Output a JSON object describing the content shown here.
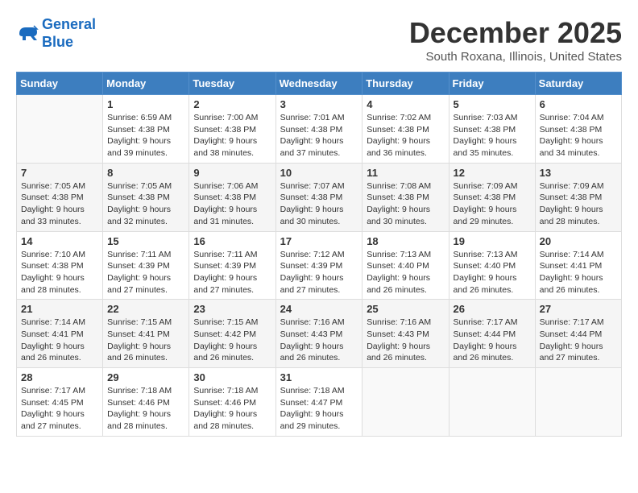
{
  "header": {
    "logo_line1": "General",
    "logo_line2": "Blue",
    "month": "December 2025",
    "location": "South Roxana, Illinois, United States"
  },
  "days_of_week": [
    "Sunday",
    "Monday",
    "Tuesday",
    "Wednesday",
    "Thursday",
    "Friday",
    "Saturday"
  ],
  "weeks": [
    [
      {
        "day": "",
        "info": ""
      },
      {
        "day": "1",
        "info": "Sunrise: 6:59 AM\nSunset: 4:38 PM\nDaylight: 9 hours\nand 39 minutes."
      },
      {
        "day": "2",
        "info": "Sunrise: 7:00 AM\nSunset: 4:38 PM\nDaylight: 9 hours\nand 38 minutes."
      },
      {
        "day": "3",
        "info": "Sunrise: 7:01 AM\nSunset: 4:38 PM\nDaylight: 9 hours\nand 37 minutes."
      },
      {
        "day": "4",
        "info": "Sunrise: 7:02 AM\nSunset: 4:38 PM\nDaylight: 9 hours\nand 36 minutes."
      },
      {
        "day": "5",
        "info": "Sunrise: 7:03 AM\nSunset: 4:38 PM\nDaylight: 9 hours\nand 35 minutes."
      },
      {
        "day": "6",
        "info": "Sunrise: 7:04 AM\nSunset: 4:38 PM\nDaylight: 9 hours\nand 34 minutes."
      }
    ],
    [
      {
        "day": "7",
        "info": "Sunrise: 7:05 AM\nSunset: 4:38 PM\nDaylight: 9 hours\nand 33 minutes."
      },
      {
        "day": "8",
        "info": "Sunrise: 7:05 AM\nSunset: 4:38 PM\nDaylight: 9 hours\nand 32 minutes."
      },
      {
        "day": "9",
        "info": "Sunrise: 7:06 AM\nSunset: 4:38 PM\nDaylight: 9 hours\nand 31 minutes."
      },
      {
        "day": "10",
        "info": "Sunrise: 7:07 AM\nSunset: 4:38 PM\nDaylight: 9 hours\nand 30 minutes."
      },
      {
        "day": "11",
        "info": "Sunrise: 7:08 AM\nSunset: 4:38 PM\nDaylight: 9 hours\nand 30 minutes."
      },
      {
        "day": "12",
        "info": "Sunrise: 7:09 AM\nSunset: 4:38 PM\nDaylight: 9 hours\nand 29 minutes."
      },
      {
        "day": "13",
        "info": "Sunrise: 7:09 AM\nSunset: 4:38 PM\nDaylight: 9 hours\nand 28 minutes."
      }
    ],
    [
      {
        "day": "14",
        "info": "Sunrise: 7:10 AM\nSunset: 4:38 PM\nDaylight: 9 hours\nand 28 minutes."
      },
      {
        "day": "15",
        "info": "Sunrise: 7:11 AM\nSunset: 4:39 PM\nDaylight: 9 hours\nand 27 minutes."
      },
      {
        "day": "16",
        "info": "Sunrise: 7:11 AM\nSunset: 4:39 PM\nDaylight: 9 hours\nand 27 minutes."
      },
      {
        "day": "17",
        "info": "Sunrise: 7:12 AM\nSunset: 4:39 PM\nDaylight: 9 hours\nand 27 minutes."
      },
      {
        "day": "18",
        "info": "Sunrise: 7:13 AM\nSunset: 4:40 PM\nDaylight: 9 hours\nand 26 minutes."
      },
      {
        "day": "19",
        "info": "Sunrise: 7:13 AM\nSunset: 4:40 PM\nDaylight: 9 hours\nand 26 minutes."
      },
      {
        "day": "20",
        "info": "Sunrise: 7:14 AM\nSunset: 4:41 PM\nDaylight: 9 hours\nand 26 minutes."
      }
    ],
    [
      {
        "day": "21",
        "info": "Sunrise: 7:14 AM\nSunset: 4:41 PM\nDaylight: 9 hours\nand 26 minutes."
      },
      {
        "day": "22",
        "info": "Sunrise: 7:15 AM\nSunset: 4:41 PM\nDaylight: 9 hours\nand 26 minutes."
      },
      {
        "day": "23",
        "info": "Sunrise: 7:15 AM\nSunset: 4:42 PM\nDaylight: 9 hours\nand 26 minutes."
      },
      {
        "day": "24",
        "info": "Sunrise: 7:16 AM\nSunset: 4:43 PM\nDaylight: 9 hours\nand 26 minutes."
      },
      {
        "day": "25",
        "info": "Sunrise: 7:16 AM\nSunset: 4:43 PM\nDaylight: 9 hours\nand 26 minutes."
      },
      {
        "day": "26",
        "info": "Sunrise: 7:17 AM\nSunset: 4:44 PM\nDaylight: 9 hours\nand 26 minutes."
      },
      {
        "day": "27",
        "info": "Sunrise: 7:17 AM\nSunset: 4:44 PM\nDaylight: 9 hours\nand 27 minutes."
      }
    ],
    [
      {
        "day": "28",
        "info": "Sunrise: 7:17 AM\nSunset: 4:45 PM\nDaylight: 9 hours\nand 27 minutes."
      },
      {
        "day": "29",
        "info": "Sunrise: 7:18 AM\nSunset: 4:46 PM\nDaylight: 9 hours\nand 28 minutes."
      },
      {
        "day": "30",
        "info": "Sunrise: 7:18 AM\nSunset: 4:46 PM\nDaylight: 9 hours\nand 28 minutes."
      },
      {
        "day": "31",
        "info": "Sunrise: 7:18 AM\nSunset: 4:47 PM\nDaylight: 9 hours\nand 29 minutes."
      },
      {
        "day": "",
        "info": ""
      },
      {
        "day": "",
        "info": ""
      },
      {
        "day": "",
        "info": ""
      }
    ]
  ]
}
